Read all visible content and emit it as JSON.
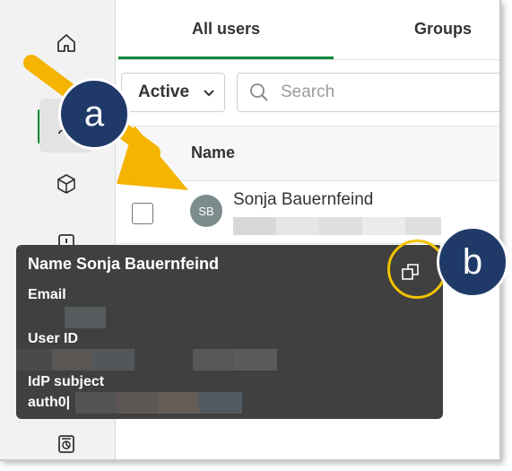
{
  "tabs": {
    "all_users": "All users",
    "groups": "Groups"
  },
  "filter": {
    "active_label": "Active"
  },
  "search": {
    "placeholder": "Search"
  },
  "table": {
    "name_header": "Name"
  },
  "user": {
    "initials": "SB",
    "name": "Sonja Bauernfeind"
  },
  "tooltip": {
    "title": "Name Sonja Bauernfeind",
    "email_label": "Email",
    "userid_label": "User ID",
    "idp_label": "IdP subject",
    "idp_value_prefix": "auth0|"
  },
  "callouts": {
    "a": "a",
    "b": "b"
  },
  "colors": {
    "accent": "#0a8a3a",
    "callout_bg": "#1f3a68",
    "highlight": "#f2c300",
    "tooltip_bg": "#404040"
  },
  "icons": [
    "home-icon",
    "users-icon",
    "cube-icon",
    "alert-icon",
    "report-icon",
    "chevron-down-icon",
    "search-icon",
    "copy-icon"
  ]
}
